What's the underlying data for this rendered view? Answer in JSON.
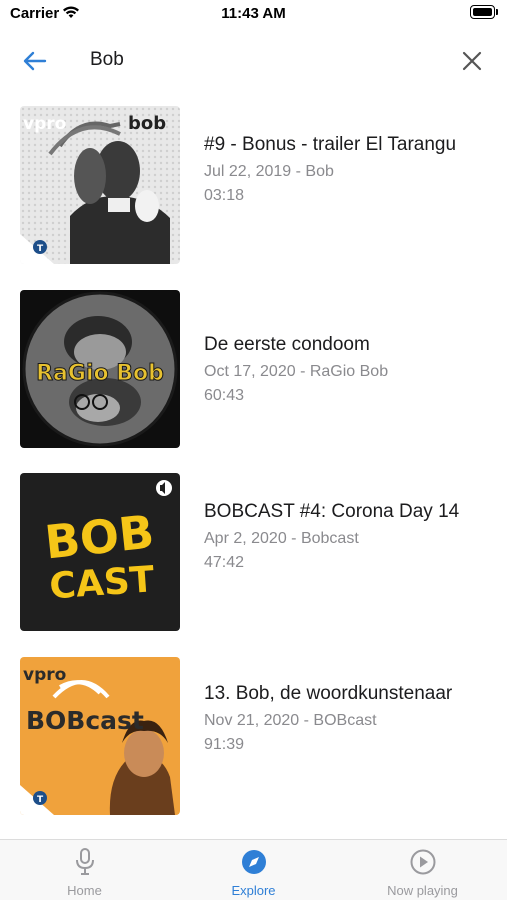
{
  "status_bar": {
    "carrier": "Carrier",
    "time": "11:43 AM"
  },
  "search": {
    "query": "Bob"
  },
  "results": [
    {
      "title": "#9 - Bonus - trailer El Tarangu",
      "date_show": "Jul 22, 2019 - Bob",
      "duration": "03:18",
      "artwork": {
        "top_left": "vpro",
        "top_right": "bob",
        "icon": "npo-corner-icon"
      }
    },
    {
      "title": "De eerste condoom",
      "date_show": "Oct 17, 2020 - RaGio Bob",
      "duration": "60:43",
      "artwork": {
        "text": "RaGio Bob"
      }
    },
    {
      "title": "BOBCAST #4: Corona Day 14",
      "date_show": "Apr 2, 2020 - Bobcast",
      "duration": "47:42",
      "artwork": {
        "line1": "BOB",
        "line2": "CAST",
        "icon": "speaker-icon"
      }
    },
    {
      "title": "13. Bob, de woordkunstenaar",
      "date_show": "Nov 21, 2020 - BOBcast",
      "duration": "91:39",
      "artwork": {
        "top_left": "vpro",
        "text": "BOBcast",
        "icon": "npo-corner-icon"
      }
    }
  ],
  "tabs": [
    {
      "label": "Home",
      "icon": "microphone-icon",
      "active": false
    },
    {
      "label": "Explore",
      "icon": "compass-icon",
      "active": true
    },
    {
      "label": "Now playing",
      "icon": "play-circle-icon",
      "active": false
    }
  ],
  "colors": {
    "accent": "#2f7fd6",
    "secondary_text": "#8a8a8e",
    "bobcast_yellow": "#f5c518",
    "bobcast_orange": "#f0a23c"
  }
}
